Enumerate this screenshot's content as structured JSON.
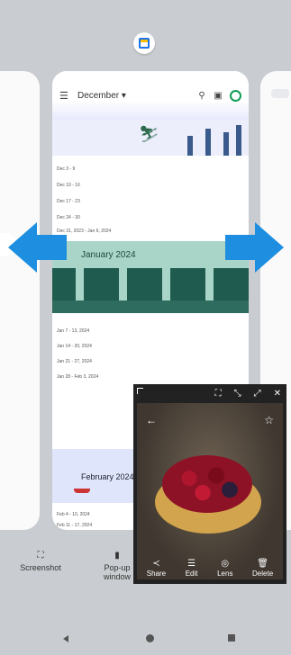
{
  "app_icon": "google-calendar-icon",
  "calendar": {
    "header_month": "December ▾",
    "weeks_december": [
      "Dec 3 - 9",
      "Dec 10 - 16",
      "Dec 17 - 23",
      "Dec 24 - 30",
      "Dec 31, 2023 - Jan 6, 2024"
    ],
    "january_title": "January 2024",
    "weeks_january": [
      "Jan 7 - 13, 2024",
      "Jan 14 - 20, 2024",
      "Jan 21 - 27, 2024",
      "Jan 28 - Feb 3, 2024"
    ],
    "february_title": "February 2024",
    "weeks_february": [
      "Feb 4 - 10, 2024",
      "Feb 11 - 17, 2024"
    ]
  },
  "popup_actions": [
    {
      "label": "Share",
      "icon": "share-icon"
    },
    {
      "label": "Edit",
      "icon": "edit-icon"
    },
    {
      "label": "Lens",
      "icon": "lens-icon"
    },
    {
      "label": "Delete",
      "icon": "delete-icon"
    }
  ],
  "tools": {
    "screenshot_label": "Screenshot",
    "popup_label": "Pop-up window"
  },
  "accent_arrow_color": "#1e8fe0"
}
